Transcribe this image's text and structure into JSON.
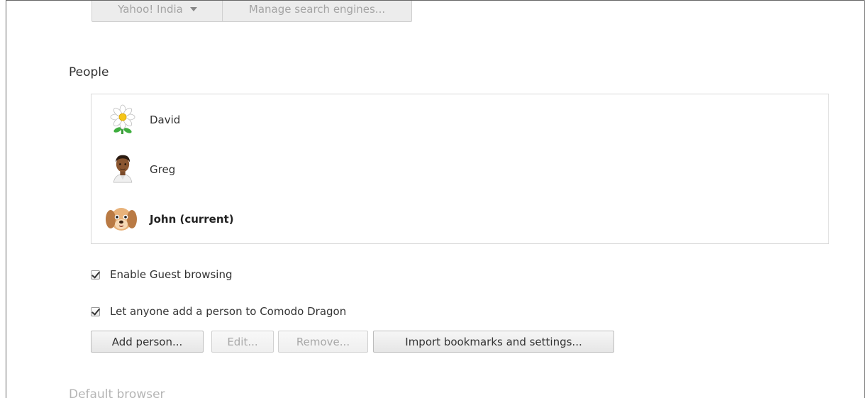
{
  "search": {
    "engine_selected": "Yahoo! India",
    "manage_label": "Manage search engines..."
  },
  "people": {
    "title": "People",
    "profiles": [
      {
        "name": "David",
        "avatar": "daisy-flower-avatar-icon"
      },
      {
        "name": "Greg",
        "avatar": "man-avatar-icon"
      },
      {
        "name": "John (current)",
        "avatar": "puppy-dog-avatar-icon"
      }
    ],
    "guest_browsing_label": "Enable Guest browsing",
    "guest_browsing_checked": true,
    "anyone_add_label": "Let anyone add a person to Comodo Dragon",
    "anyone_add_checked": true,
    "buttons": {
      "add": "Add person...",
      "edit": "Edit...",
      "remove": "Remove...",
      "import": "Import bookmarks and settings..."
    }
  },
  "default_browser": {
    "title": "Default browser"
  }
}
